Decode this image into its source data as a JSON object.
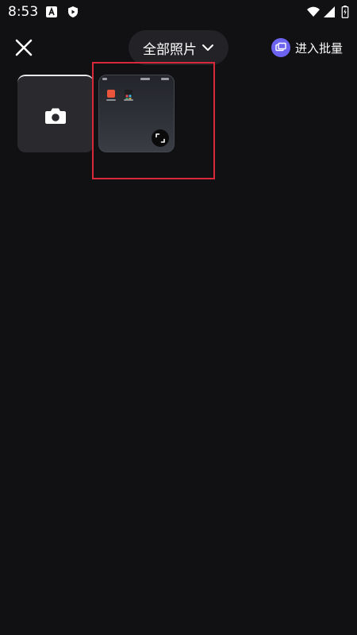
{
  "status_bar": {
    "time": "8:53",
    "icons": [
      "android-auto-icon",
      "play-store-icon",
      "wifi-icon",
      "signal-icon",
      "battery-charging-icon"
    ]
  },
  "toolbar": {
    "close_icon": "close-icon",
    "album_label": "全部照片",
    "album_chevron_icon": "chevron-down-icon",
    "batch_label": "进入批量",
    "batch_icon": "batch-select-icon"
  },
  "grid": {
    "items": [
      {
        "kind": "camera",
        "icon": "camera-icon"
      },
      {
        "kind": "photo",
        "icon": "expand-icon"
      }
    ]
  },
  "colors": {
    "background": "#111113",
    "selector_bg": "#232327",
    "batch_accent": "#6c63f0",
    "highlight": "#d9283a"
  }
}
